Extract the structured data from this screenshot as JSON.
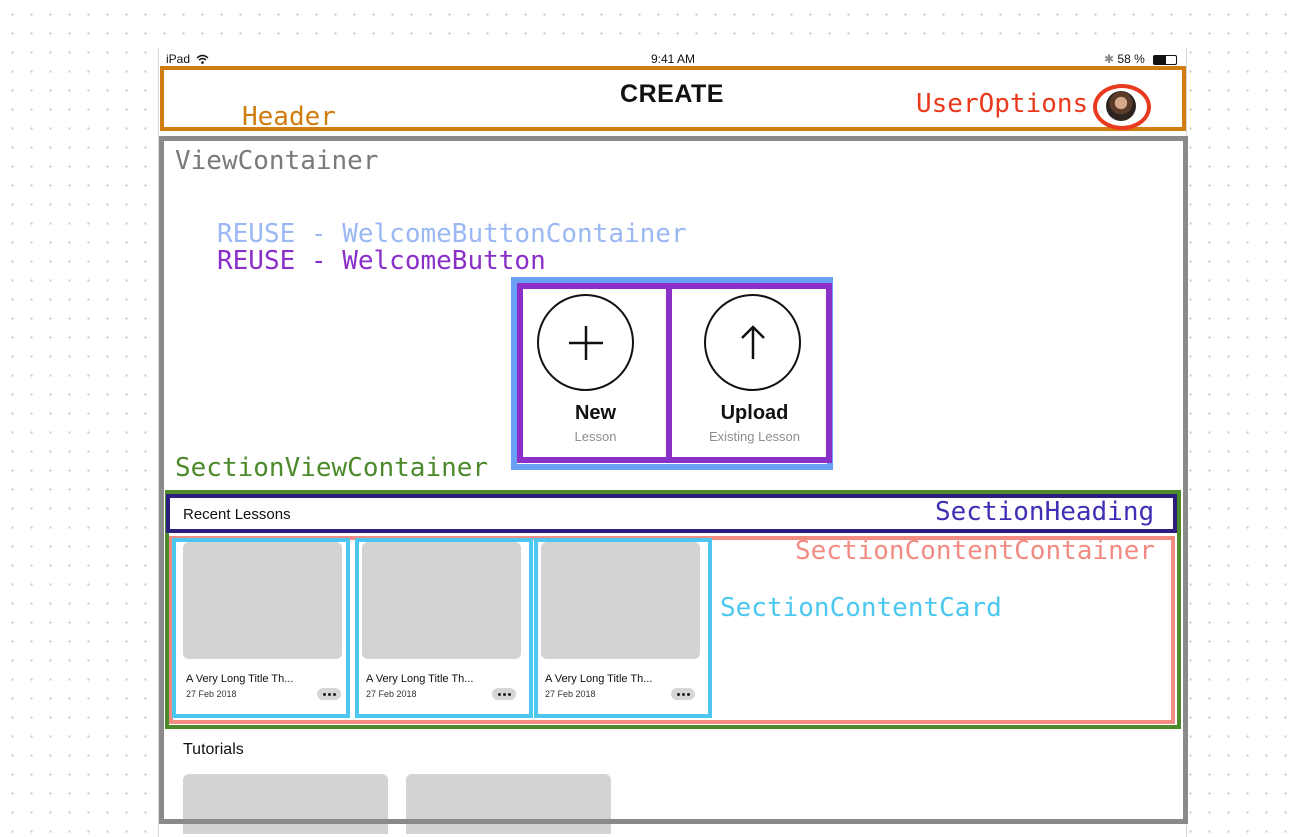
{
  "status_bar": {
    "device": "iPad",
    "time": "9:41 AM",
    "battery": "58 %"
  },
  "header": {
    "title": "CREATE"
  },
  "welcome_buttons": [
    {
      "icon": "plus-icon",
      "title": "New",
      "subtitle": "Lesson"
    },
    {
      "icon": "arrow-up-icon",
      "title": "Upload",
      "subtitle": "Existing Lesson"
    }
  ],
  "recent_lessons": {
    "heading": "Recent Lessons",
    "cards": [
      {
        "title": "A Very Long Title Th...",
        "date": "27 Feb 2018"
      },
      {
        "title": "A Very Long Title Th...",
        "date": "27 Feb 2018"
      },
      {
        "title": "A Very Long Title Th...",
        "date": "27 Feb 2018"
      }
    ]
  },
  "tutorials": {
    "heading": "Tutorials"
  },
  "annotations": {
    "header": "Header",
    "user_options": "UserOptions",
    "view_container": "ViewContainer",
    "welcome_button_container": "REUSE - WelcomeButtonContainer",
    "welcome_button": "REUSE - WelcomeButton",
    "section_view_container": "SectionViewContainer",
    "section_heading": "SectionHeading",
    "section_content_container": "SectionContentContainer",
    "section_content_card": "SectionContentCard"
  },
  "colors": {
    "header": "#d07d10",
    "user_options": "#ea3a1d",
    "view_container": "#8a8a8a",
    "welcome_button_container": "#6a9ff6",
    "welcome_button": "#8b2fc9",
    "section_view_container": "#4c8a2b",
    "section_heading": "#2b1f7d",
    "section_content_container": "#f28c82",
    "section_content_card": "#4cc8f0"
  }
}
